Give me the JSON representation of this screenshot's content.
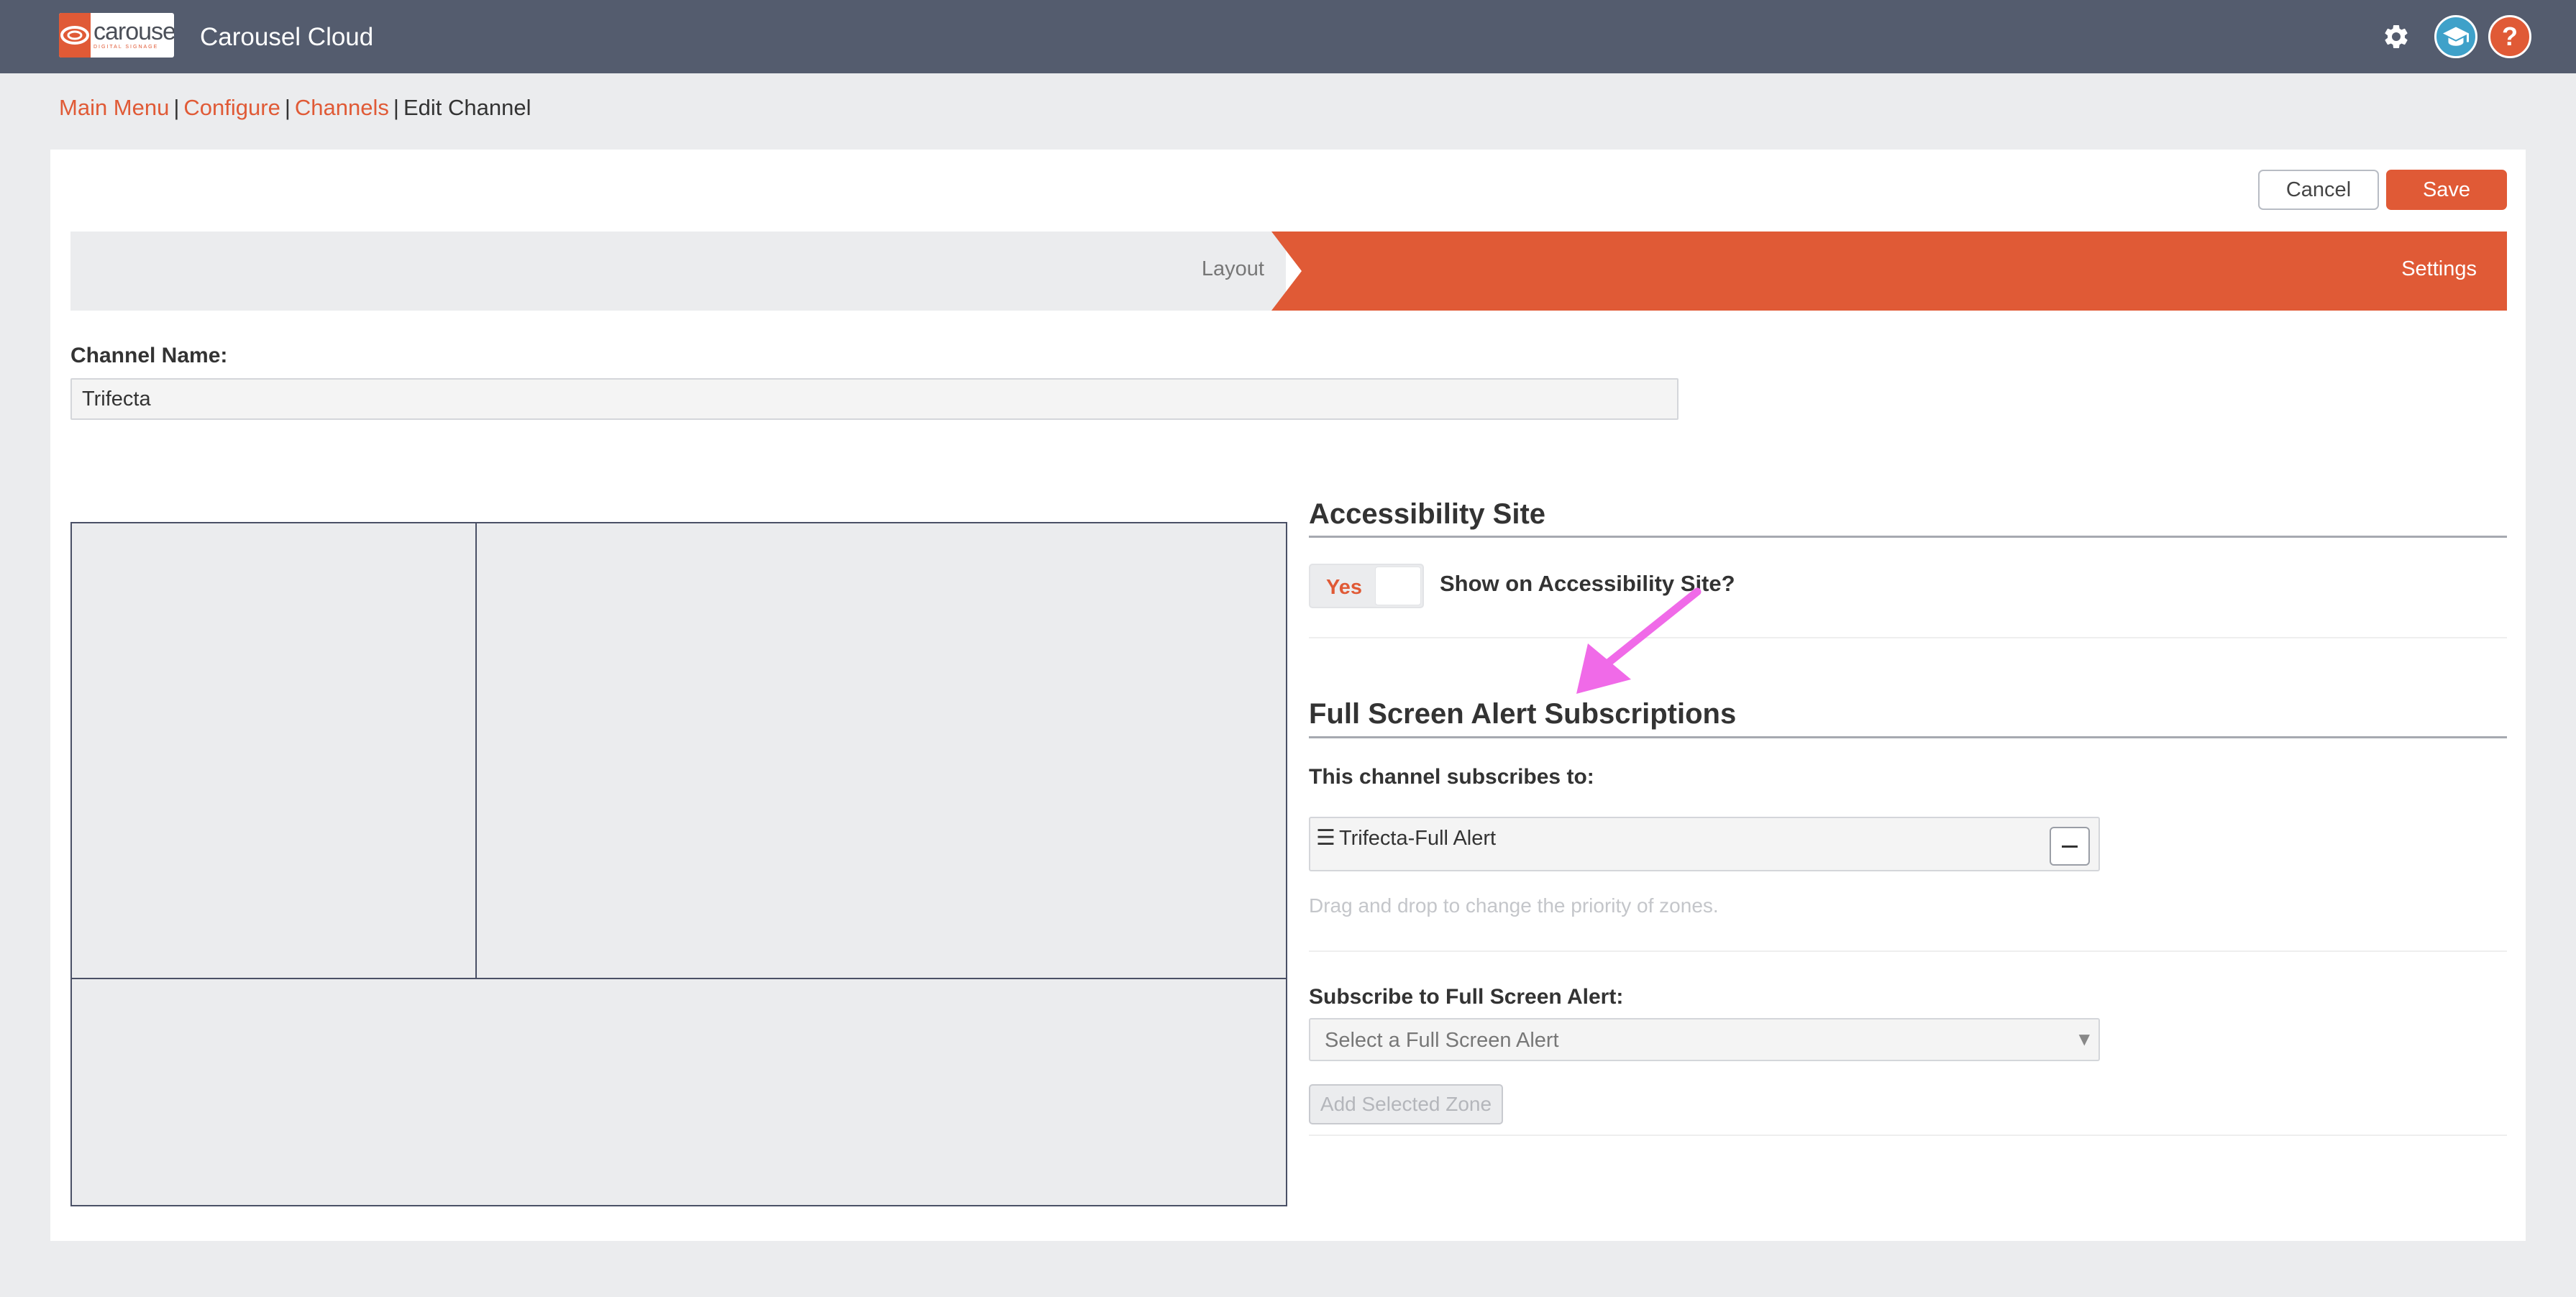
{
  "app": {
    "title": "Carousel Cloud",
    "logo_text": "carousel",
    "logo_subtext": "DIGITAL SIGNAGE",
    "help_glyph": "?"
  },
  "icons": {
    "settings": "gear-icon",
    "training": "graduation-cap-icon",
    "help": "help-icon",
    "drag_handle": "drag-handle-icon",
    "remove": "minus-icon",
    "dropdown": "chevron-down-icon",
    "annotation": "arrow-annotation-icon"
  },
  "colors": {
    "accent": "#e05a36",
    "topbar": "#545c6e",
    "training": "#3fa1c9",
    "annotation": "#f06ae8"
  },
  "breadcrumb": {
    "items": [
      "Main Menu",
      "Configure",
      "Channels"
    ],
    "separator": "|",
    "current": "Edit Channel"
  },
  "actions": {
    "cancel_label": "Cancel",
    "save_label": "Save"
  },
  "steps": {
    "layout_label": "Layout",
    "settings_label": "Settings",
    "active": "Settings"
  },
  "channel": {
    "name_label": "Channel Name:",
    "name_value": "Trifecta"
  },
  "accessibility": {
    "title": "Accessibility Site",
    "toggle_label": "Yes",
    "toggle_on": true,
    "question": "Show on Accessibility Site?"
  },
  "alerts": {
    "title": "Full Screen Alert Subscriptions",
    "subscribes_label": "This channel subscribes to:",
    "subscriptions": [
      "Trifecta-Full Alert"
    ],
    "drag_hint": "Drag and drop to change the priority of zones.",
    "subscribe_label": "Subscribe to Full Screen Alert:",
    "select_placeholder": "Select a Full Screen Alert",
    "add_button_label": "Add Selected Zone"
  }
}
